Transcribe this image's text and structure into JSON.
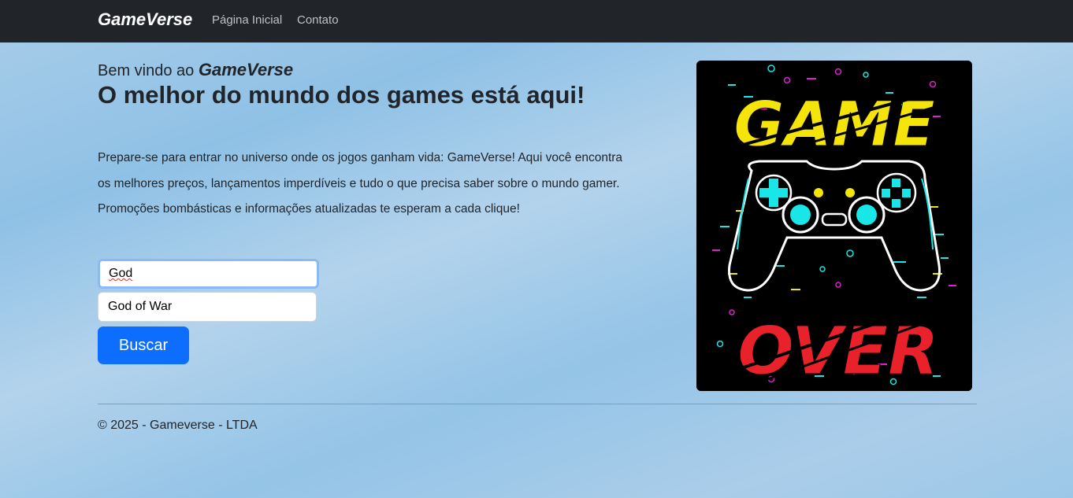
{
  "navbar": {
    "brand": "GameVerse",
    "links": [
      {
        "label": "Página Inicial"
      },
      {
        "label": "Contato"
      }
    ]
  },
  "hero": {
    "welcome_prefix": "Bem vindo ao",
    "welcome_brand": "GameVerse",
    "headline": "O melhor do mundo dos games está aqui!",
    "intro_lines": [
      "Prepare-se para entrar no universo onde os jogos ganham vida: GameVerse! Aqui você encontra",
      "os melhores preços, lançamentos imperdíveis e tudo o que precisa saber sobre o mundo gamer.",
      "Promoções bombásticas e informações atualizadas te esperam a cada clique!"
    ]
  },
  "search": {
    "value": "God",
    "suggestion": "God of War",
    "button_label": "Buscar"
  },
  "poster": {
    "top_word": "GAME",
    "bottom_word": "OVER",
    "colors": {
      "background": "#000000",
      "game_text": "#f5e40a",
      "over_text": "#e8212a",
      "controller": "#ffffff",
      "accent_cyan": "#19e6e6",
      "accent_magenta": "#e020d0"
    }
  },
  "footer": {
    "text": "© 2025 - Gameverse - LTDA"
  },
  "colors": {
    "navbar_bg": "#212529",
    "button_bg": "#0d6efd",
    "text": "#212529"
  }
}
